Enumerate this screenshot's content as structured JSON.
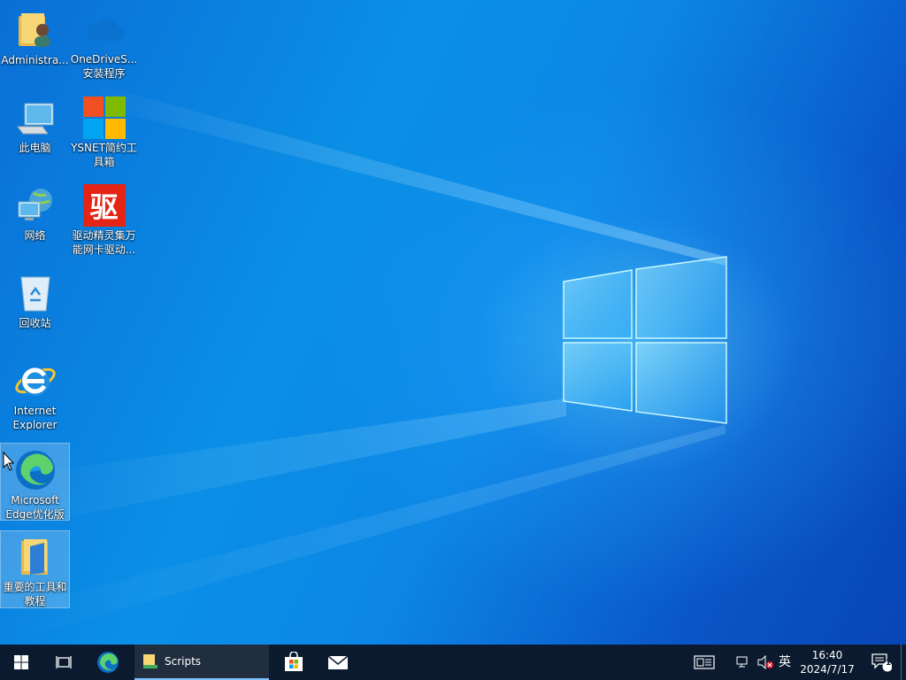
{
  "desktop": {
    "icons": [
      {
        "label": "Administra...",
        "icon": "user-folder-icon"
      },
      {
        "label": "OneDriveS...\n安装程序",
        "icon": "onedrive-icon"
      },
      {
        "label": "此电脑",
        "icon": "computer-icon"
      },
      {
        "label": "YSNET简约工\n具箱",
        "icon": "windows-logo-icon"
      },
      {
        "label": "网络",
        "icon": "network-icon"
      },
      {
        "label": "驱动精灵集万\n能网卡驱动...",
        "icon": "driver-genius-icon",
        "glyph": "驱"
      },
      {
        "label": "回收站",
        "icon": "recycle-bin-icon"
      },
      {
        "label": "Internet\nExplorer",
        "icon": "internet-explorer-icon"
      },
      {
        "label": "Microsoft\nEdge优化版",
        "icon": "edge-icon"
      },
      {
        "label": "重要的工具和\n教程",
        "icon": "folder-icon"
      }
    ]
  },
  "taskbar": {
    "start": "windows-start-icon",
    "task_view": "task-view-icon",
    "pinned": [
      "edge-icon",
      "store-icon",
      "mail-icon"
    ],
    "active_app": {
      "label": "Scripts",
      "icon": "scripts-folder-icon"
    },
    "tray": {
      "news": "news-icon",
      "network": "network-tray-icon",
      "volume": "volume-muted-icon",
      "ime": "英",
      "time": "16:40",
      "date": "2024/7/17",
      "notifications_count": "1"
    }
  },
  "colors": {
    "taskbar": "#0b1a2e",
    "accent": "#0a78d7"
  }
}
